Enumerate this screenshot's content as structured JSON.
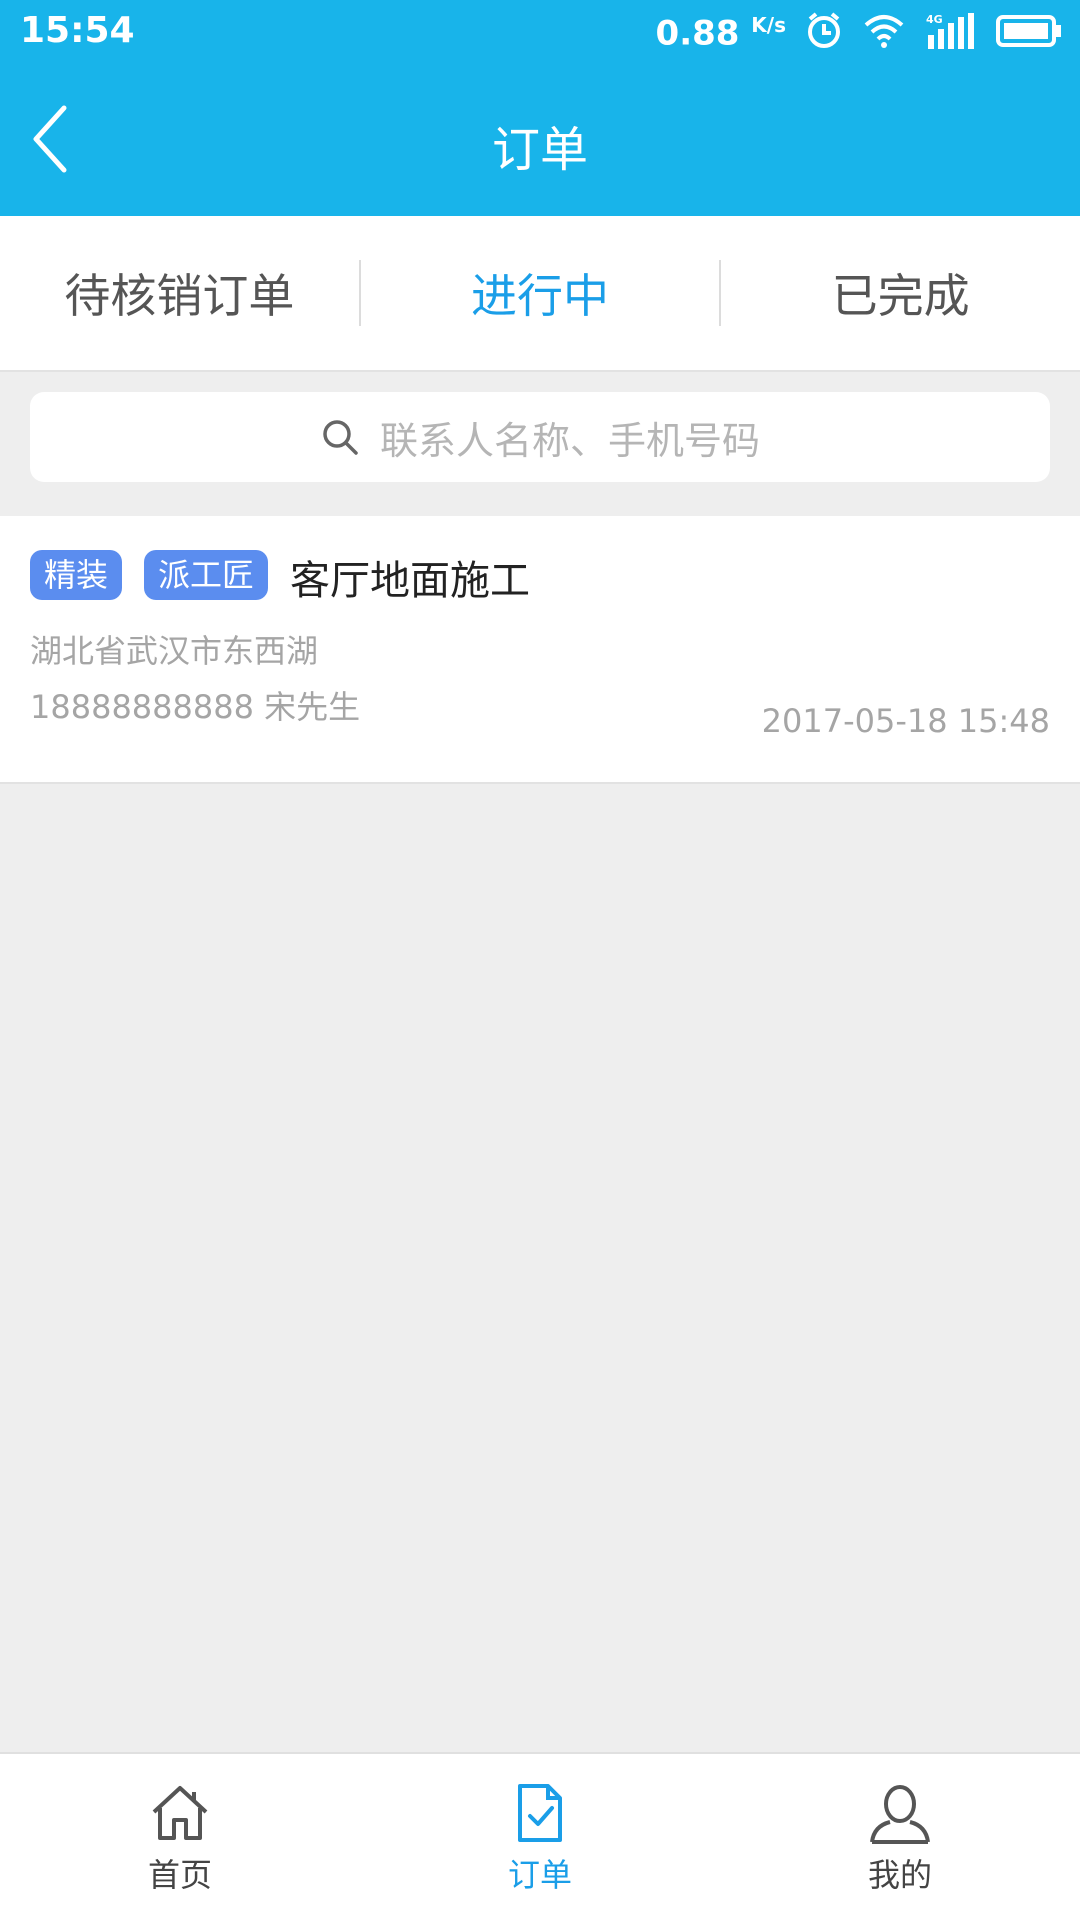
{
  "status_bar": {
    "time": "15:54",
    "net_speed": "0.88",
    "net_unit": "K/s",
    "icons": [
      "alarm-icon",
      "wifi-icon",
      "signal-4g-icon",
      "battery-icon"
    ]
  },
  "app_bar": {
    "title": "订单",
    "back_icon": "chevron-left-icon"
  },
  "tabs": [
    {
      "label": "待核销订单",
      "active": false
    },
    {
      "label": "进行中",
      "active": true
    },
    {
      "label": "已完成",
      "active": false
    }
  ],
  "search": {
    "placeholder": "联系人名称、手机号码",
    "icon": "search-icon"
  },
  "orders": [
    {
      "badges": [
        "精装",
        "派工匠"
      ],
      "title": "客厅地面施工",
      "address": "湖北省武汉市东西湖",
      "contact": "18888888888  宋先生",
      "time": "2017-05-18 15:48"
    }
  ],
  "bottom_nav": [
    {
      "label": "首页",
      "icon": "home-icon",
      "active": false
    },
    {
      "label": "订单",
      "icon": "order-document-icon",
      "active": true
    },
    {
      "label": "我的",
      "icon": "user-icon",
      "active": false
    }
  ],
  "colors": {
    "primary": "#18b4ea",
    "active_tab": "#1a9ee8",
    "badge": "#5b8def",
    "background": "#eeeeee"
  }
}
